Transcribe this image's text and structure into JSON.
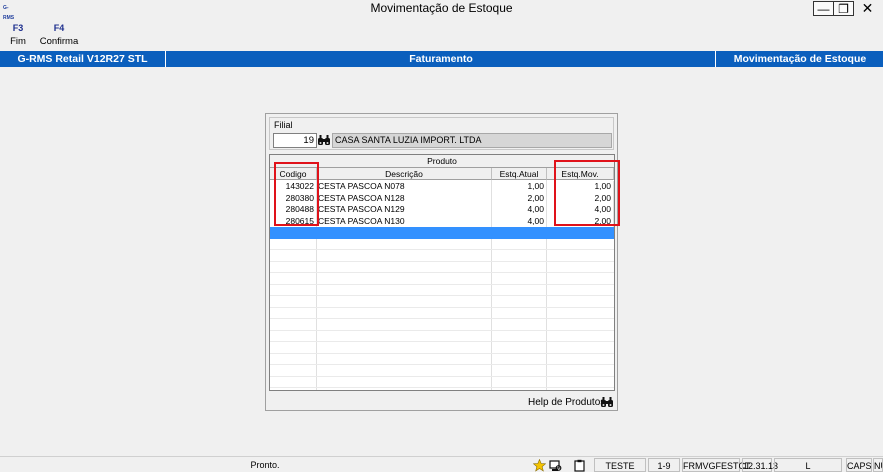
{
  "window": {
    "title": "Movimentação de Estoque",
    "app_icon": "G-RMS",
    "min_glyph": "—",
    "max_glyph": "❐",
    "close_glyph": "✕"
  },
  "toolbar": {
    "f3": {
      "key": "F3",
      "label": "Fim"
    },
    "f4": {
      "key": "F4",
      "label": "Confirma"
    }
  },
  "header": {
    "system": "G-RMS Retail V12R27 STL",
    "module": "Faturamento",
    "program": "Movimentação de Estoque"
  },
  "filial": {
    "label": "Filial",
    "code": "19",
    "name": "CASA SANTA LUZIA IMPORT. LTDA"
  },
  "grid": {
    "group_header": "Produto",
    "columns": {
      "codigo": "Codigo",
      "descricao": "Descrição",
      "estq_atual": "Estq.Atual",
      "estq_mov": "Estq.Mov."
    },
    "rows": [
      {
        "codigo": "143022",
        "descricao": "CESTA PASCOA N078",
        "estq_atual": "1,00",
        "estq_mov": "1,00"
      },
      {
        "codigo": "280380",
        "descricao": "CESTA PASCOA N128",
        "estq_atual": "2,00",
        "estq_mov": "2,00"
      },
      {
        "codigo": "280488",
        "descricao": "CESTA PASCOA N129",
        "estq_atual": "4,00",
        "estq_mov": "4,00"
      },
      {
        "codigo": "280615",
        "descricao": "CESTA PASCOA N130",
        "estq_atual": "4,00",
        "estq_mov": "2,00"
      }
    ],
    "selected_row_color": "#3391ff"
  },
  "help_produtos": "Help de Produtos",
  "status": {
    "message": "Pronto.",
    "perfil": "TESTE",
    "sessao": "1-9",
    "form": "FRMVGFESTCT",
    "hora": "12.31.13",
    "modo": "L",
    "caps": "CAPS",
    "num": "NUM"
  },
  "colors": {
    "header_blue": "#0b5fbd",
    "highlight_red": "#e0121a"
  }
}
